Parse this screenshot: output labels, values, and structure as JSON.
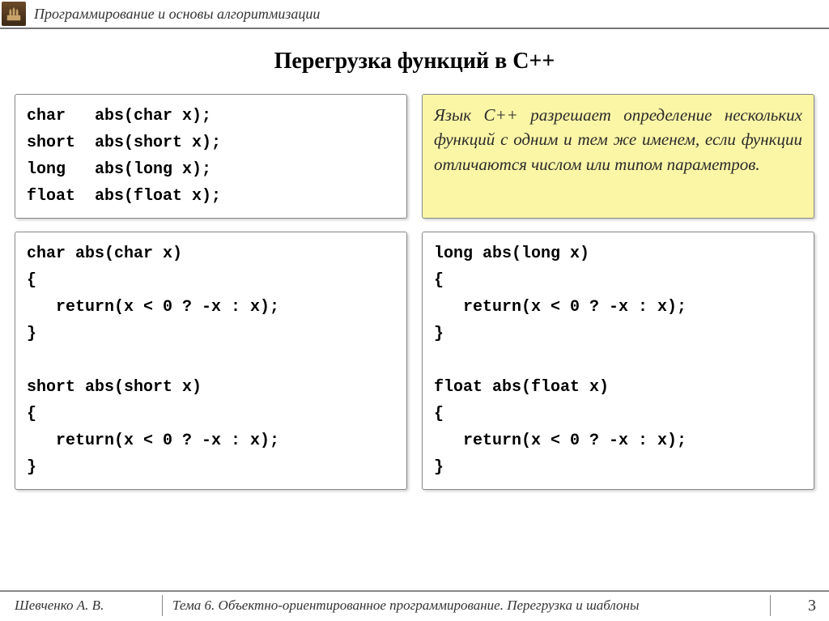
{
  "header": {
    "course": "Программирование и основы алгоритмизации"
  },
  "title": "Перегрузка функций в С++",
  "declarations": "char   abs(char x);\nshort  abs(short x);\nlong   abs(long x);\nfloat  abs(float x);",
  "callout": "Язык С++ разрешает определение нескольких функций с одним и тем же именем, если функции отличаются числом или типом параметров.",
  "code_left": "char abs(char x)\n{\n   return(x < 0 ? -x : x);\n}\n\nshort abs(short x)\n{\n   return(x < 0 ? -x : x);\n}",
  "code_right": "long abs(long x)\n{\n   return(x < 0 ? -x : x);\n}\n\nfloat abs(float x)\n{\n   return(x < 0 ? -x : x);\n}",
  "footer": {
    "author": "Шевченко А. В.",
    "topic": "Тема 6. Объектно-ориентированное программирование. Перегрузка и шаблоны",
    "page": "3"
  }
}
